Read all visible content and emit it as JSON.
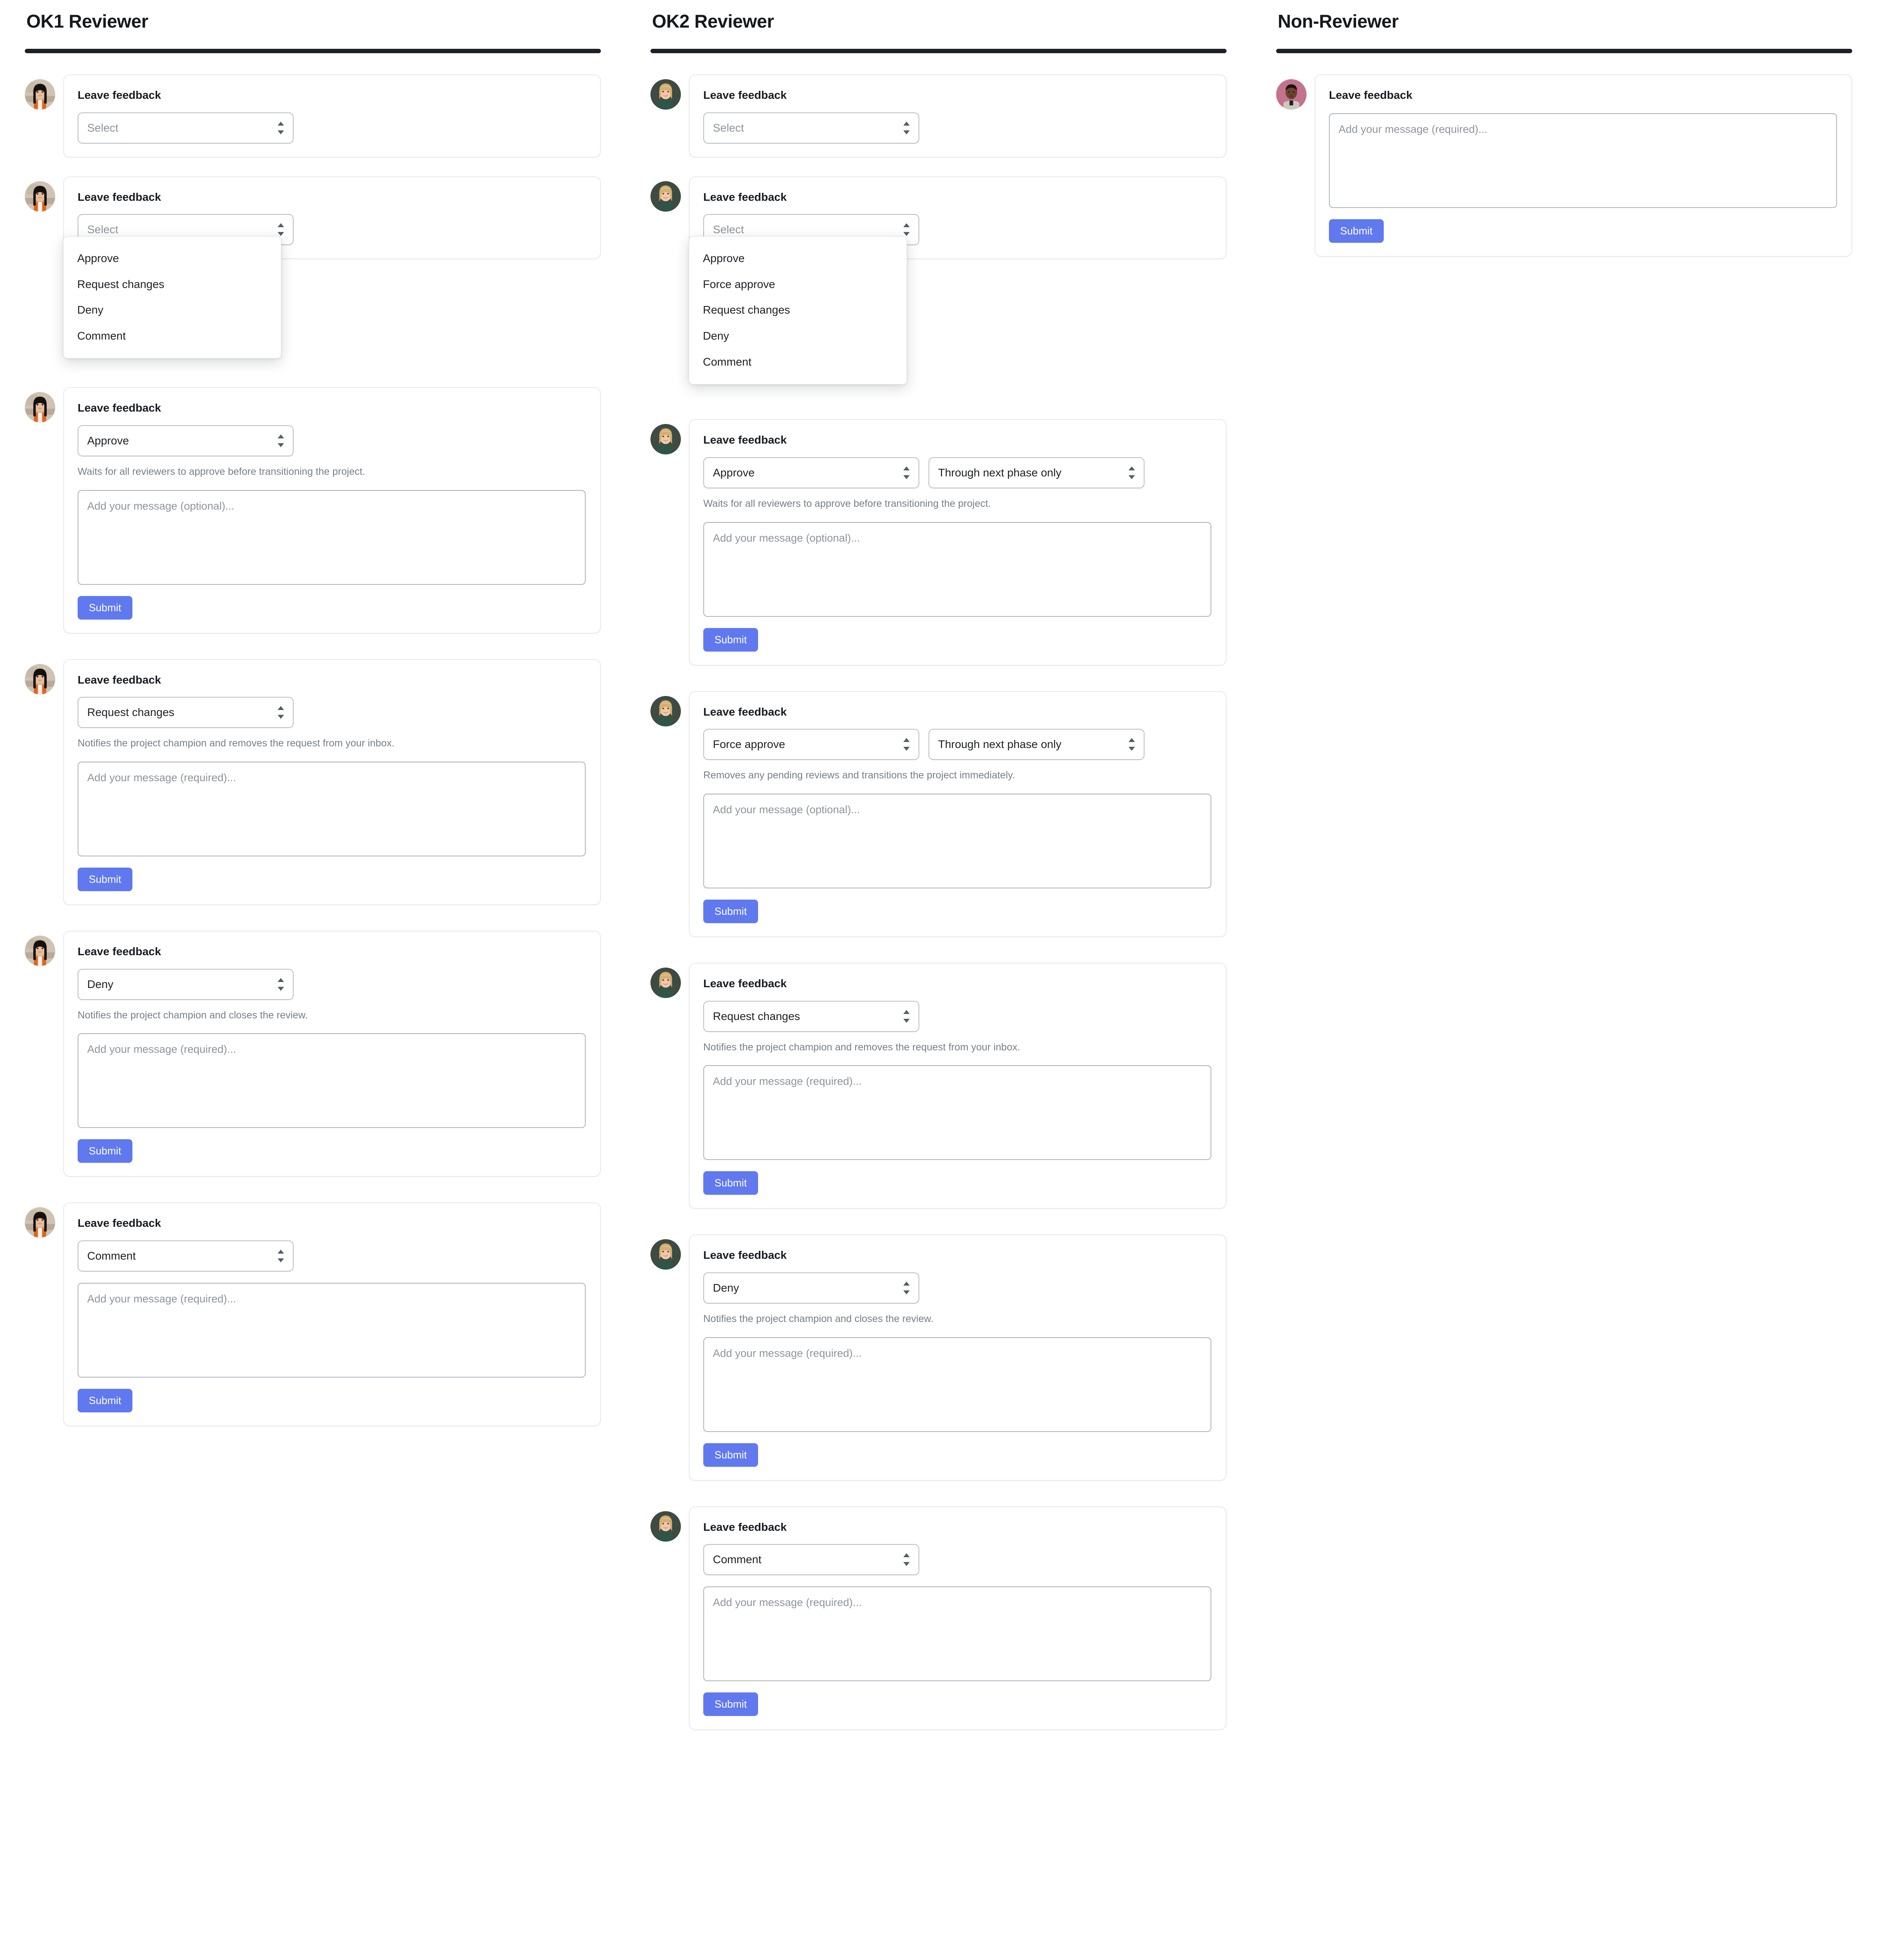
{
  "columns": [
    {
      "key": "ok1",
      "title": "OK1 Reviewer",
      "avatar": "asian-woman-orange-jacket-avatar",
      "dropdown_options": [
        "Approve",
        "Request changes",
        "Deny",
        "Comment"
      ],
      "cards": [
        {
          "id": "ok1-collapsed",
          "label": "Leave feedback",
          "select_value": "Select",
          "select_is_placeholder": true,
          "helper": "",
          "textarea_placeholder": "",
          "submit_label": "",
          "show_textarea": false,
          "show_submit": false,
          "menu_open": false
        },
        {
          "id": "ok1-menu-open",
          "label": "Leave feedback",
          "select_value": "Select",
          "select_is_placeholder": true,
          "helper": "",
          "textarea_placeholder": "",
          "submit_label": "",
          "show_textarea": false,
          "show_submit": false,
          "menu_open": true
        },
        {
          "id": "ok1-approve",
          "label": "Leave feedback",
          "select_value": "Approve",
          "select_is_placeholder": false,
          "helper": "Waits for all reviewers to approve before transitioning the project.",
          "textarea_placeholder": "Add your message (optional)...",
          "submit_label": "Submit",
          "show_textarea": true,
          "show_submit": true,
          "menu_open": false
        },
        {
          "id": "ok1-request-changes",
          "label": "Leave feedback",
          "select_value": "Request changes",
          "select_is_placeholder": false,
          "helper": "Notifies the project champion and removes the request from your inbox.",
          "textarea_placeholder": "Add your message (required)...",
          "submit_label": "Submit",
          "show_textarea": true,
          "show_submit": true,
          "menu_open": false
        },
        {
          "id": "ok1-deny",
          "label": "Leave feedback",
          "select_value": "Deny",
          "select_is_placeholder": false,
          "helper": "Notifies the project champion and closes the review.",
          "textarea_placeholder": "Add your message (required)...",
          "submit_label": "Submit",
          "show_textarea": true,
          "show_submit": true,
          "menu_open": false
        },
        {
          "id": "ok1-comment",
          "label": "Leave feedback",
          "select_value": "Comment",
          "select_is_placeholder": false,
          "helper": "",
          "textarea_placeholder": "Add your message (required)...",
          "submit_label": "Submit",
          "show_textarea": true,
          "show_submit": true,
          "menu_open": false
        }
      ]
    },
    {
      "key": "ok2",
      "title": "OK2 Reviewer",
      "avatar": "blonde-woman-green-top-avatar",
      "dropdown_options": [
        "Approve",
        "Force approve",
        "Request changes",
        "Deny",
        "Comment"
      ],
      "cards": [
        {
          "id": "ok2-collapsed",
          "label": "Leave feedback",
          "select_value": "Select",
          "select_is_placeholder": true,
          "helper": "",
          "textarea_placeholder": "",
          "submit_label": "",
          "show_textarea": false,
          "show_submit": false,
          "menu_open": false,
          "second_select": ""
        },
        {
          "id": "ok2-menu-open",
          "label": "Leave feedback",
          "select_value": "Select",
          "select_is_placeholder": true,
          "helper": "",
          "textarea_placeholder": "",
          "submit_label": "",
          "show_textarea": false,
          "show_submit": false,
          "menu_open": true,
          "second_select": ""
        },
        {
          "id": "ok2-approve",
          "label": "Leave feedback",
          "select_value": "Approve",
          "select_is_placeholder": false,
          "second_select": "Through next phase only",
          "helper": "Waits for all reviewers to approve before transitioning the project.",
          "textarea_placeholder": "Add your message (optional)...",
          "submit_label": "Submit",
          "show_textarea": true,
          "show_submit": true,
          "menu_open": false
        },
        {
          "id": "ok2-force-approve",
          "label": "Leave feedback",
          "select_value": "Force approve",
          "select_is_placeholder": false,
          "second_select": "Through next phase only",
          "helper": "Removes any pending reviews and transitions the project immediately.",
          "textarea_placeholder": "Add your message (optional)...",
          "submit_label": "Submit",
          "show_textarea": true,
          "show_submit": true,
          "menu_open": false
        },
        {
          "id": "ok2-request-changes",
          "label": "Leave feedback",
          "select_value": "Request changes",
          "select_is_placeholder": false,
          "second_select": "",
          "helper": "Notifies the project champion and removes the request from your inbox.",
          "textarea_placeholder": "Add your message (required)...",
          "submit_label": "Submit",
          "show_textarea": true,
          "show_submit": true,
          "menu_open": false
        },
        {
          "id": "ok2-deny",
          "label": "Leave feedback",
          "select_value": "Deny",
          "select_is_placeholder": false,
          "second_select": "",
          "helper": "Notifies the project champion and closes the review.",
          "textarea_placeholder": "Add your message (required)...",
          "submit_label": "Submit",
          "show_textarea": true,
          "show_submit": true,
          "menu_open": false
        },
        {
          "id": "ok2-comment",
          "label": "Leave feedback",
          "select_value": "Comment",
          "select_is_placeholder": false,
          "second_select": "",
          "helper": "",
          "textarea_placeholder": "Add your message (required)...",
          "submit_label": "Submit",
          "show_textarea": true,
          "show_submit": true,
          "menu_open": false
        }
      ]
    },
    {
      "key": "nonreviewer",
      "title": "Non-Reviewer",
      "avatar": "man-pink-background-avatar",
      "dropdown_options": [],
      "cards": [
        {
          "id": "nonreviewer-comment",
          "label": "Leave feedback",
          "select_value": "",
          "select_is_placeholder": false,
          "helper": "",
          "textarea_placeholder": "Add your message (required)...",
          "submit_label": "Submit",
          "show_select": false,
          "show_textarea": true,
          "show_submit": true,
          "menu_open": false
        }
      ]
    }
  ],
  "colors": {
    "accent_submit": "#6179ef",
    "rule": "#1d2026",
    "card_border": "#e7e9ee",
    "field_border": "#b9bec7",
    "helper_text": "#777e89",
    "placeholder_text": "#8d939d"
  }
}
